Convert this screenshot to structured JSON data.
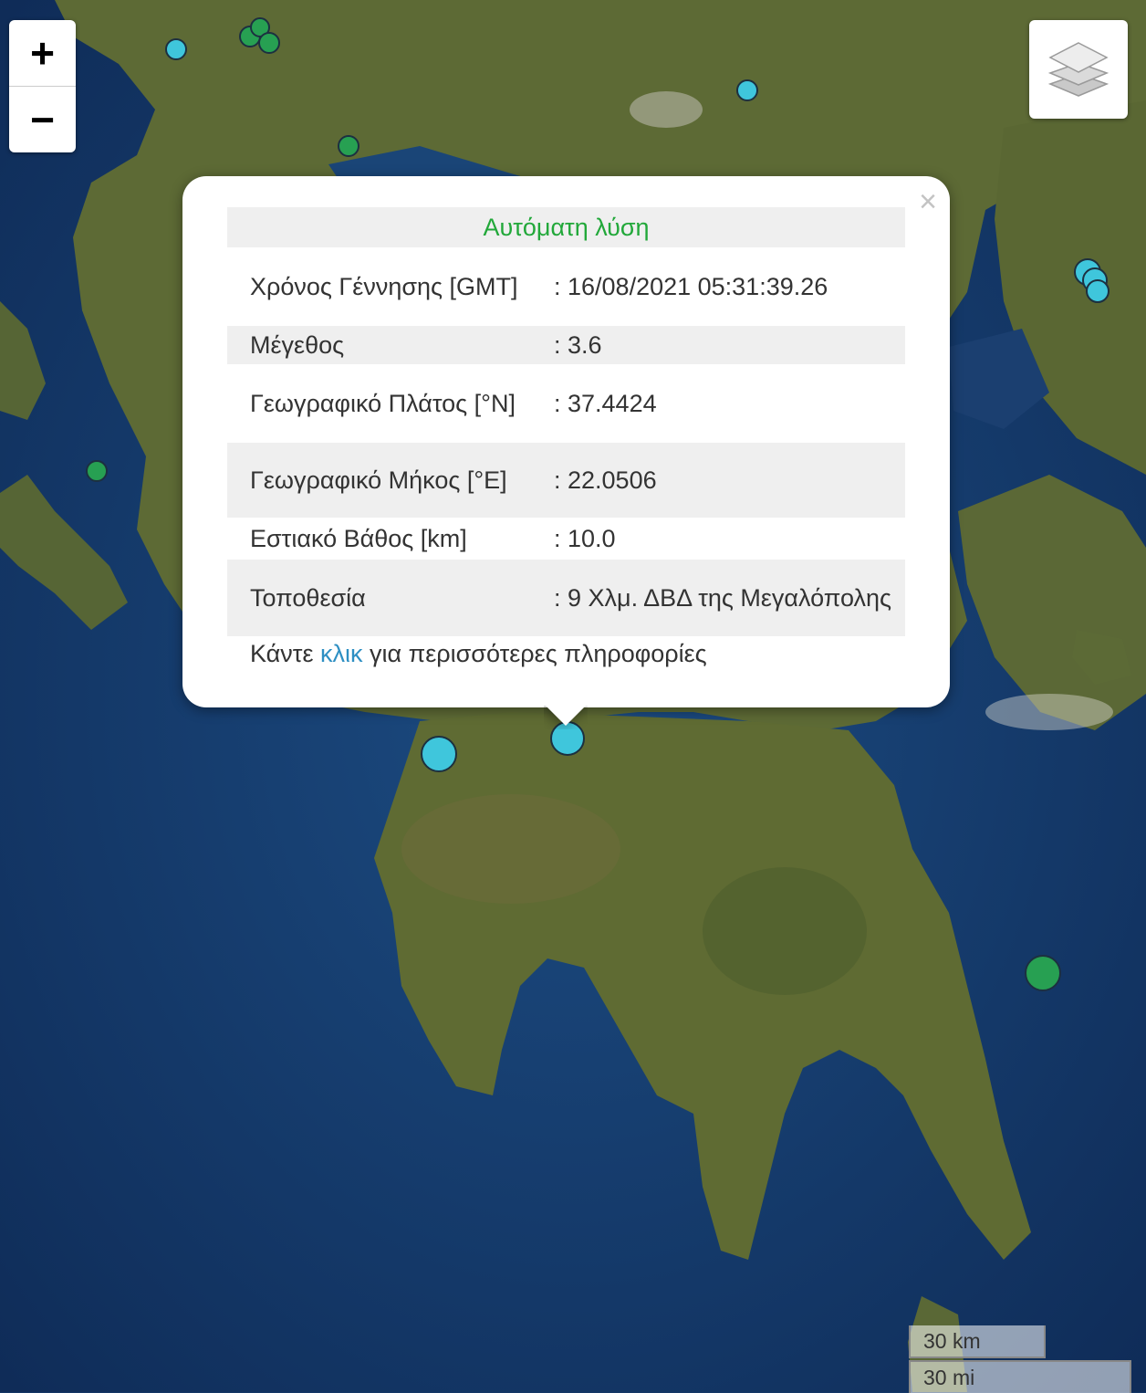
{
  "map": {
    "zoom_in": "+",
    "zoom_out": "−",
    "layers_icon": "layers-icon",
    "colors": {
      "sea": "#143766",
      "land": "#5e6b34",
      "marker_cyan": "#3fc6dc",
      "marker_green": "#27a052"
    }
  },
  "popup": {
    "title": "Αυτόματη λύση",
    "close": "×",
    "rows": [
      {
        "label": "Χρόνος Γέννησης [GMT]",
        "value": ": 16/08/2021 05:31:39.26"
      },
      {
        "label": "Μέγεθος",
        "value": ": 3.6"
      },
      {
        "label": "Γεωγραφικό Πλάτος [°N]",
        "value": ": 37.4424"
      },
      {
        "label": "Γεωγραφικό Μήκος [°E]",
        "value": ": 22.0506"
      },
      {
        "label": "Εστιακό Βάθος [km]",
        "value": ": 10.0"
      },
      {
        "label": "Τοποθεσία",
        "value": ": 9 Χλμ. ΔΒΔ της Μεγαλόπολης"
      }
    ],
    "more_before": "Κάντε ",
    "more_link": "κλικ",
    "more_after": " για περισσότερες πληροφορίες"
  },
  "scale": {
    "km": "30 km",
    "mi": "30 mi"
  }
}
